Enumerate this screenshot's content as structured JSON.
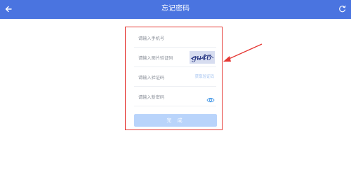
{
  "header": {
    "title": "忘记密码",
    "back_icon": "back-arrow-icon",
    "refresh_icon": "refresh-icon",
    "background": "#4a74e0"
  },
  "form": {
    "phone_placeholder": "请输入手机号",
    "captcha_placeholder": "请输入图片验证码",
    "captcha_text": "gu46",
    "code_placeholder": "请输入验证码",
    "get_code_label": "获取验证码",
    "new_password_placeholder": "请输入新密码",
    "password_toggle_icon": "eye-icon",
    "submit_label": "完 成",
    "submit_color": "#b9d4fb",
    "highlight_color": "#e53935"
  }
}
